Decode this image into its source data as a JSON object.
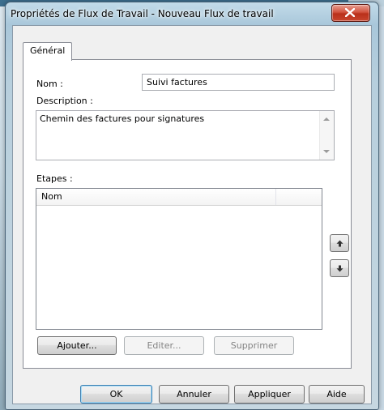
{
  "window": {
    "title": "Propriétés de Flux de Travail - Nouveau Flux de travail"
  },
  "tabs": [
    {
      "label": "Général",
      "selected": true
    }
  ],
  "form": {
    "name_label": "Nom :",
    "name_value": "Suivi factures",
    "description_label": "Description :",
    "description_value": "Chemin des factures pour signatures",
    "steps_label": "Etapes :",
    "steps_columns": [
      "Nom",
      ""
    ],
    "steps_rows": []
  },
  "step_buttons": {
    "add": "Ajouter...",
    "edit": "Editer...",
    "delete": "Supprimer"
  },
  "dialog_buttons": {
    "ok": "OK",
    "cancel": "Annuler",
    "apply": "Appliquer",
    "help": "Aide"
  },
  "icons": {
    "close": "close-icon",
    "move_up": "arrow-up-icon",
    "move_down": "arrow-down-icon"
  },
  "colors": {
    "close_button": "#c8452e",
    "default_button_border": "#3c7fb1"
  }
}
